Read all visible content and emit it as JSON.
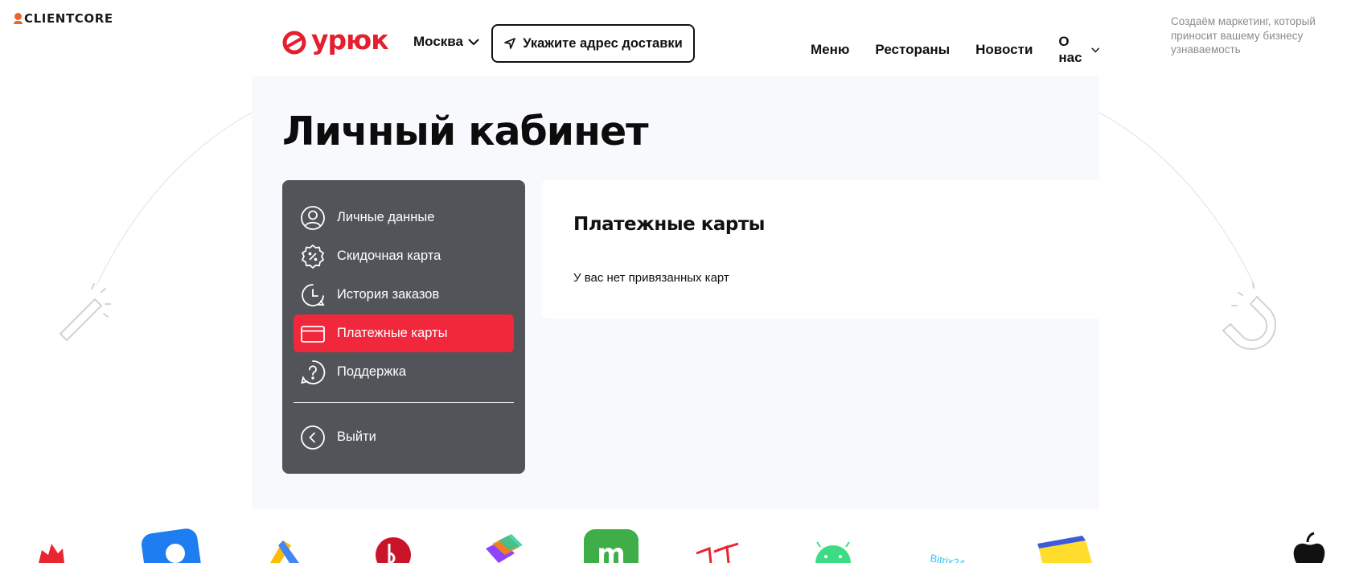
{
  "agency": {
    "logo_text": "CLIENTCORE",
    "tagline": "Создаём маркетинг, который приносит вашему бизнесу узнаваемость"
  },
  "header": {
    "brand": "урюк",
    "city": "Москва",
    "address_button": "Укажите адрес доставки",
    "nav": [
      {
        "label": "Меню"
      },
      {
        "label": "Рестораны"
      },
      {
        "label": "Новости"
      },
      {
        "label": "О нас"
      }
    ]
  },
  "page": {
    "title": "Личный кабинет"
  },
  "sidebar": {
    "items": [
      {
        "label": "Личные данные",
        "icon": "user-icon"
      },
      {
        "label": "Скидочная карта",
        "icon": "discount-badge-icon"
      },
      {
        "label": "История заказов",
        "icon": "history-icon"
      },
      {
        "label": "Платежные карты",
        "icon": "credit-card-icon",
        "active": true
      },
      {
        "label": "Поддержка",
        "icon": "help-icon"
      }
    ],
    "logout": {
      "label": "Выйти",
      "icon": "chevron-left-circle-icon"
    }
  },
  "cards": {
    "title": "Платежные карты",
    "empty_text": "У вас нет привязанных карт"
  },
  "colors": {
    "brand_red": "#e5202e",
    "active_red": "#f1283b",
    "sidebar_bg": "#525459",
    "content_bg": "#f8f9fc",
    "agency_orange": "#f0612e"
  }
}
